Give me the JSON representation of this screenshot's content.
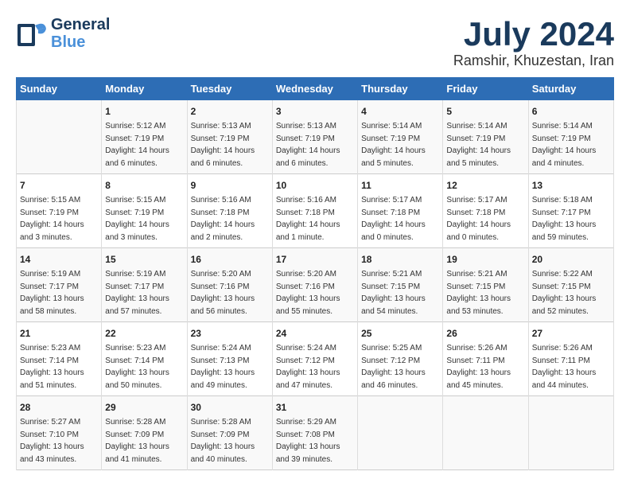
{
  "header": {
    "logo_line1": "General",
    "logo_line2": "Blue",
    "month_title": "July 2024",
    "location": "Ramshir, Khuzestan, Iran"
  },
  "weekdays": [
    "Sunday",
    "Monday",
    "Tuesday",
    "Wednesday",
    "Thursday",
    "Friday",
    "Saturday"
  ],
  "weeks": [
    [
      {
        "day": "",
        "info": ""
      },
      {
        "day": "1",
        "info": "Sunrise: 5:12 AM\nSunset: 7:19 PM\nDaylight: 14 hours\nand 6 minutes."
      },
      {
        "day": "2",
        "info": "Sunrise: 5:13 AM\nSunset: 7:19 PM\nDaylight: 14 hours\nand 6 minutes."
      },
      {
        "day": "3",
        "info": "Sunrise: 5:13 AM\nSunset: 7:19 PM\nDaylight: 14 hours\nand 6 minutes."
      },
      {
        "day": "4",
        "info": "Sunrise: 5:14 AM\nSunset: 7:19 PM\nDaylight: 14 hours\nand 5 minutes."
      },
      {
        "day": "5",
        "info": "Sunrise: 5:14 AM\nSunset: 7:19 PM\nDaylight: 14 hours\nand 5 minutes."
      },
      {
        "day": "6",
        "info": "Sunrise: 5:14 AM\nSunset: 7:19 PM\nDaylight: 14 hours\nand 4 minutes."
      }
    ],
    [
      {
        "day": "7",
        "info": "Sunrise: 5:15 AM\nSunset: 7:19 PM\nDaylight: 14 hours\nand 3 minutes."
      },
      {
        "day": "8",
        "info": "Sunrise: 5:15 AM\nSunset: 7:19 PM\nDaylight: 14 hours\nand 3 minutes."
      },
      {
        "day": "9",
        "info": "Sunrise: 5:16 AM\nSunset: 7:18 PM\nDaylight: 14 hours\nand 2 minutes."
      },
      {
        "day": "10",
        "info": "Sunrise: 5:16 AM\nSunset: 7:18 PM\nDaylight: 14 hours\nand 1 minute."
      },
      {
        "day": "11",
        "info": "Sunrise: 5:17 AM\nSunset: 7:18 PM\nDaylight: 14 hours\nand 0 minutes."
      },
      {
        "day": "12",
        "info": "Sunrise: 5:17 AM\nSunset: 7:18 PM\nDaylight: 14 hours\nand 0 minutes."
      },
      {
        "day": "13",
        "info": "Sunrise: 5:18 AM\nSunset: 7:17 PM\nDaylight: 13 hours\nand 59 minutes."
      }
    ],
    [
      {
        "day": "14",
        "info": "Sunrise: 5:19 AM\nSunset: 7:17 PM\nDaylight: 13 hours\nand 58 minutes."
      },
      {
        "day": "15",
        "info": "Sunrise: 5:19 AM\nSunset: 7:17 PM\nDaylight: 13 hours\nand 57 minutes."
      },
      {
        "day": "16",
        "info": "Sunrise: 5:20 AM\nSunset: 7:16 PM\nDaylight: 13 hours\nand 56 minutes."
      },
      {
        "day": "17",
        "info": "Sunrise: 5:20 AM\nSunset: 7:16 PM\nDaylight: 13 hours\nand 55 minutes."
      },
      {
        "day": "18",
        "info": "Sunrise: 5:21 AM\nSunset: 7:15 PM\nDaylight: 13 hours\nand 54 minutes."
      },
      {
        "day": "19",
        "info": "Sunrise: 5:21 AM\nSunset: 7:15 PM\nDaylight: 13 hours\nand 53 minutes."
      },
      {
        "day": "20",
        "info": "Sunrise: 5:22 AM\nSunset: 7:15 PM\nDaylight: 13 hours\nand 52 minutes."
      }
    ],
    [
      {
        "day": "21",
        "info": "Sunrise: 5:23 AM\nSunset: 7:14 PM\nDaylight: 13 hours\nand 51 minutes."
      },
      {
        "day": "22",
        "info": "Sunrise: 5:23 AM\nSunset: 7:14 PM\nDaylight: 13 hours\nand 50 minutes."
      },
      {
        "day": "23",
        "info": "Sunrise: 5:24 AM\nSunset: 7:13 PM\nDaylight: 13 hours\nand 49 minutes."
      },
      {
        "day": "24",
        "info": "Sunrise: 5:24 AM\nSunset: 7:12 PM\nDaylight: 13 hours\nand 47 minutes."
      },
      {
        "day": "25",
        "info": "Sunrise: 5:25 AM\nSunset: 7:12 PM\nDaylight: 13 hours\nand 46 minutes."
      },
      {
        "day": "26",
        "info": "Sunrise: 5:26 AM\nSunset: 7:11 PM\nDaylight: 13 hours\nand 45 minutes."
      },
      {
        "day": "27",
        "info": "Sunrise: 5:26 AM\nSunset: 7:11 PM\nDaylight: 13 hours\nand 44 minutes."
      }
    ],
    [
      {
        "day": "28",
        "info": "Sunrise: 5:27 AM\nSunset: 7:10 PM\nDaylight: 13 hours\nand 43 minutes."
      },
      {
        "day": "29",
        "info": "Sunrise: 5:28 AM\nSunset: 7:09 PM\nDaylight: 13 hours\nand 41 minutes."
      },
      {
        "day": "30",
        "info": "Sunrise: 5:28 AM\nSunset: 7:09 PM\nDaylight: 13 hours\nand 40 minutes."
      },
      {
        "day": "31",
        "info": "Sunrise: 5:29 AM\nSunset: 7:08 PM\nDaylight: 13 hours\nand 39 minutes."
      },
      {
        "day": "",
        "info": ""
      },
      {
        "day": "",
        "info": ""
      },
      {
        "day": "",
        "info": ""
      }
    ]
  ]
}
